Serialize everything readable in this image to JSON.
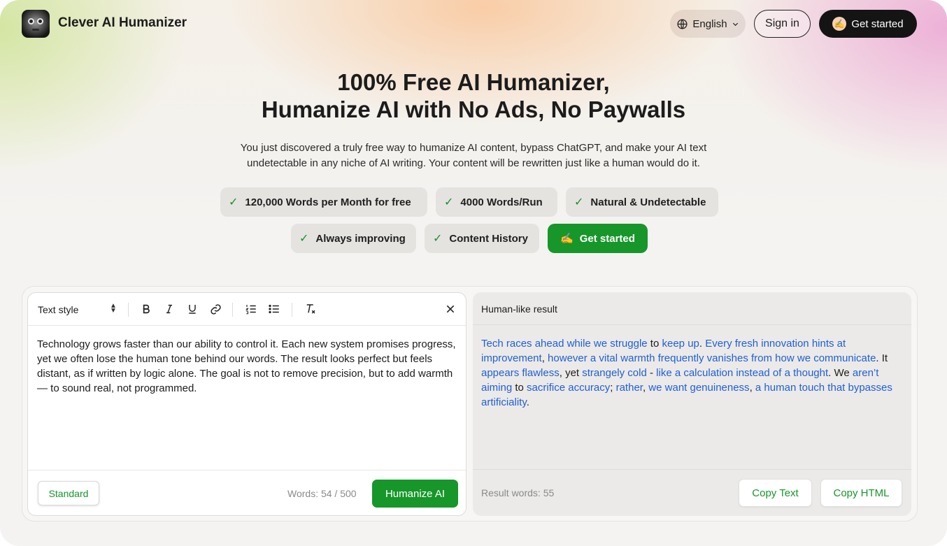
{
  "header": {
    "brand": "Clever AI Humanizer",
    "language": "English",
    "signin": "Sign in",
    "get_started": "Get started",
    "get_started_emoji": "✍️"
  },
  "hero": {
    "title_line1": "100% Free AI Humanizer,",
    "title_line2": "Humanize AI with No Ads, No Paywalls",
    "subtitle_line1": "You just discovered a truly free way to humanize AI content, bypass ChatGPT, and make your AI text",
    "subtitle_line2": "undetectable in any niche of AI writing. Your content will be rewritten just like a human would do it.",
    "features": [
      "120,000 Words per Month for free",
      "4000 Words/Run",
      "Natural & Undetectable",
      "Always improving",
      "Content History"
    ],
    "cta": "Get started",
    "cta_emoji": "✍️"
  },
  "editor": {
    "text_style": "Text style",
    "text": "Technology grows faster than our ability to control it. Each new system promises progress, yet we often lose the human tone behind our words. The result looks perfect but feels distant, as if written by logic alone. The goal is not to remove precision, but to add warmth — to sound real, not programmed.",
    "mode_button": "Standard",
    "word_count": "Words: 54 / 500",
    "humanize_button": "Humanize AI"
  },
  "result": {
    "title": "Human-like result",
    "segments": [
      {
        "t": "Tech races ahead while we struggle",
        "h": true
      },
      {
        "t": " to ",
        "h": false
      },
      {
        "t": "keep up",
        "h": true
      },
      {
        "t": ". ",
        "h": false
      },
      {
        "t": "Every fresh innovation hints at improvement",
        "h": true
      },
      {
        "t": ", ",
        "h": false
      },
      {
        "t": "however a vital warmth frequently vanishes from how we communicate",
        "h": true
      },
      {
        "t": ". It ",
        "h": false
      },
      {
        "t": "appears flawless",
        "h": true
      },
      {
        "t": ", yet ",
        "h": false
      },
      {
        "t": "strangely cold",
        "h": true
      },
      {
        "t": " - ",
        "h": false
      },
      {
        "t": "like a calculation instead of a thought",
        "h": true
      },
      {
        "t": ". We ",
        "h": false
      },
      {
        "t": "aren’t aiming",
        "h": true
      },
      {
        "t": " to ",
        "h": false
      },
      {
        "t": "sacrifice accuracy",
        "h": true
      },
      {
        "t": "; ",
        "h": false
      },
      {
        "t": "rather",
        "h": true
      },
      {
        "t": ", ",
        "h": false
      },
      {
        "t": "we want genuineness",
        "h": true
      },
      {
        "t": ", ",
        "h": false
      },
      {
        "t": "a human touch that bypasses artificiality",
        "h": true
      },
      {
        "t": ".",
        "h": false
      }
    ],
    "word_count": "Result words: 55",
    "copy_text": "Copy Text",
    "copy_html": "Copy HTML"
  },
  "colors": {
    "accent_green": "#17962a",
    "highlight_blue": "#1f5fd6"
  }
}
